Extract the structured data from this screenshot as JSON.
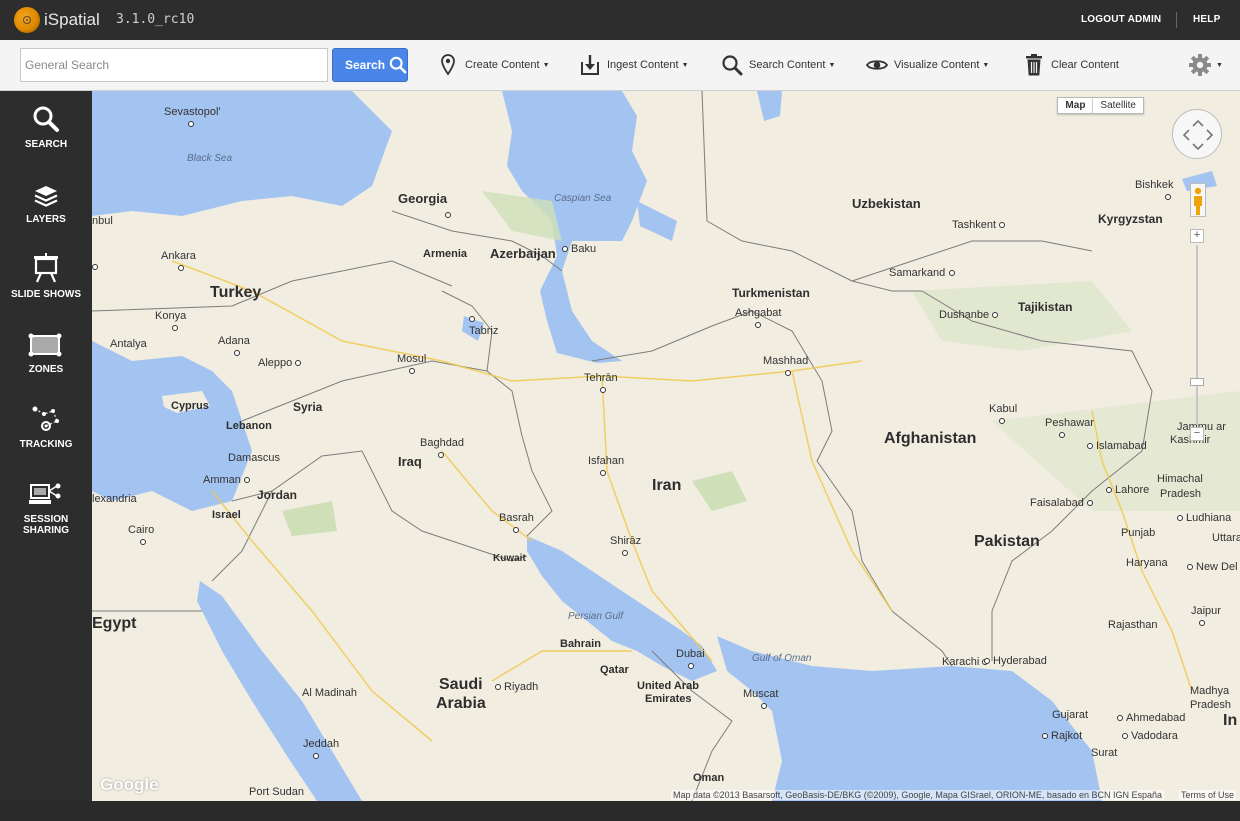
{
  "app": {
    "brand": "iSpatial",
    "version": "3.1.0_rc10"
  },
  "topnav": {
    "logout": "LOGOUT ADMIN",
    "help": "HELP"
  },
  "toolbar": {
    "search_placeholder": "General Search",
    "search_button": "Search",
    "create": "Create Content",
    "ingest": "Ingest Content",
    "search_content": "Search Content",
    "visualize": "Visualize Content",
    "clear": "Clear Content",
    "settings_icon": "gear-icon"
  },
  "sidebar": [
    {
      "label": "SEARCH",
      "icon": "search-icon"
    },
    {
      "label": "LAYERS",
      "icon": "layers-icon"
    },
    {
      "label": "SLIDE SHOWS",
      "icon": "easel-icon"
    },
    {
      "label": "ZONES",
      "icon": "zone-icon"
    },
    {
      "label": "TRACKING",
      "icon": "tracking-icon"
    },
    {
      "label": "SESSION",
      "label2": "SHARING",
      "icon": "session-sharing-icon"
    }
  ],
  "map": {
    "type_map": "Map",
    "type_satellite": "Satellite",
    "selected_type": "Map",
    "google": "Google",
    "attribution": "Map data ©2013 Basarsoft, GeoBasis-DE/BKG (©2009), Google, Mapa GISrael, ORION-ME, basado en BCN IGN España",
    "terms": "Terms of Use",
    "labels": {
      "sevastopol": "Sevastopol'",
      "black_sea": "Black Sea",
      "caspian_sea": "Caspian Sea",
      "georgia": "Georgia",
      "armenia": "Armenia",
      "azerbaijan": "Azerbaijan",
      "baku": "Baku",
      "uzbekistan": "Uzbekistan",
      "bishkek": "Bishkek",
      "tashkent": "Tashkent",
      "kyrgyzstan": "Kyrgyzstan",
      "samarkand": "Samarkand",
      "turkmenistan": "Turkmenistan",
      "ashgabat": "Ashgabat",
      "dushanbe": "Dushanbe",
      "tajikistan": "Tajikistan",
      "istanbul": "nbul",
      "ankara": "Ankara",
      "turkey": "Turkey",
      "konya": "Konya",
      "tabriz": "Tabriz",
      "antalya": "Antalya",
      "adana": "Adana",
      "mosul": "Mosul",
      "mashhad": "Mashhad",
      "aleppo": "Aleppo",
      "tehran": "Tehrān",
      "cyprus": "Cyprus",
      "syria": "Syria",
      "kabul": "Kabul",
      "lebanon": "Lebanon",
      "baghdad": "Baghdad",
      "afghanistan": "Afghanistan",
      "peshawar": "Peshawar",
      "jammu": "Jammu ar",
      "kashmir": "Kashmir",
      "damascus": "Damascus",
      "iraq": "Iraq",
      "isfahan": "Isfahan",
      "islamabad": "Islamabad",
      "amman": "Amman",
      "jordan": "Jordan",
      "iran": "Iran",
      "lahore": "Lahore",
      "himachal": "Himachal",
      "pradesh": "Pradesh",
      "alexandria": "lexandria",
      "israel": "Israel",
      "basrah": "Basrah",
      "faisalabad": "Faisalabad",
      "ludhiana": "Ludhiana",
      "cairo": "Cairo",
      "shiraz": "Shirāz",
      "pakistan": "Pakistan",
      "punjab": "Punjab",
      "uttarakhand": "Uttara",
      "kuwait": "Kuwait",
      "haryana": "Haryana",
      "new_delhi": "New Del",
      "egypt": "Egypt",
      "persian_gulf": "Persian Gulf",
      "jaipur": "Jaipur",
      "bahrain": "Bahrain",
      "rajasthan": "Rajasthan",
      "dubai": "Dubai",
      "gulf_of_oman": "Gulf of Oman",
      "qatar": "Qatar",
      "karachi": "Karachi",
      "hyderabad": "Hyderabad",
      "saudi": "Saudi",
      "arabia": "Arabia",
      "riyadh": "Riyadh",
      "uae1": "United Arab",
      "uae2": "Emirates",
      "muscat": "Muscat",
      "madhya": "Madhya",
      "madhya2": "Pradesh",
      "al_madinah": "Al Madinah",
      "gujarat": "Gujarat",
      "ahmedabad": "Ahmedabad",
      "india": "In",
      "jeddah": "Jeddah",
      "rajkot": "Rajkot",
      "vadodara": "Vadodara",
      "surat": "Surat",
      "oman": "Oman",
      "port_sudan": "Port Sudan"
    }
  }
}
